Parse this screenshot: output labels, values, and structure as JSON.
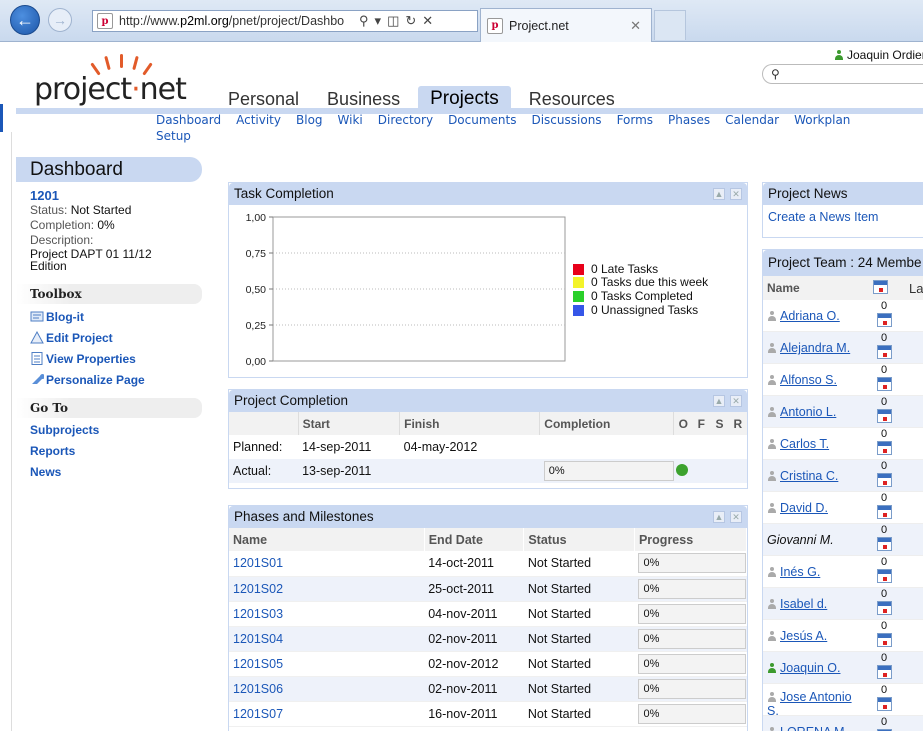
{
  "browser": {
    "url_prefix": "http://www.",
    "url_domain": "p2ml.org",
    "url_rest": "/pnet/project/Dashbo",
    "tab_title": "Project.net",
    "favicon_letter": "p"
  },
  "header": {
    "logo_text_a": "project",
    "logo_dot": "·",
    "logo_text_b": "net",
    "user_name": "Joaquin Ordieres",
    "main_nav": [
      "Personal",
      "Business",
      "Projects",
      "Resources"
    ],
    "sub_nav": [
      "Dashboard",
      "Activity",
      "Blog",
      "Wiki",
      "Directory",
      "Documents",
      "Discussions",
      "Forms",
      "Phases",
      "Calendar",
      "Workplan"
    ],
    "sub_nav_setup": "Setup"
  },
  "sidebar": {
    "title": "Dashboard",
    "project_id": "1201",
    "status_label": "Status:",
    "status_value": "Not Started",
    "completion_label": "Completion:",
    "completion_value": "0%",
    "description_label": "Description:",
    "description_value": "Project DAPT 01 11/12 Edition",
    "toolbox_title": "Toolbox",
    "toolbox": [
      "Blog-it",
      "Edit Project",
      "View Properties",
      "Personalize Page"
    ],
    "goto_title": "Go To",
    "goto": [
      "Subprojects",
      "Reports",
      "News"
    ]
  },
  "task_completion": {
    "title": "Task Completion",
    "legend": [
      "0 Late Tasks",
      "0 Tasks due this week",
      "0 Tasks Completed",
      "0 Unassigned Tasks"
    ]
  },
  "chart_data": {
    "type": "bar",
    "categories": [
      "Late Tasks",
      "Tasks due this week",
      "Tasks Completed",
      "Unassigned Tasks"
    ],
    "values": [
      0,
      0,
      0,
      0
    ],
    "colors": [
      "#e8001a",
      "#f3f32a",
      "#2ad02a",
      "#3556e8"
    ],
    "title": "",
    "xlabel": "",
    "ylabel": "",
    "ylim": [
      0,
      1
    ],
    "yticks": [
      "1,00",
      "0,75",
      "0,50",
      "0,25",
      "0,00"
    ],
    "grid": true,
    "legend_position": "right"
  },
  "project_completion": {
    "title": "Project Completion",
    "headers": [
      "",
      "Start",
      "Finish",
      "Completion",
      "O",
      "F",
      "S",
      "R"
    ],
    "rows": [
      {
        "label": "Planned:",
        "start": "14-sep-2011",
        "finish": "04-may-2012",
        "completion": ""
      },
      {
        "label": "Actual:",
        "start": "13-sep-2011",
        "finish": "",
        "completion": "0%"
      }
    ],
    "status_color": "#3ca22e"
  },
  "phases": {
    "title": "Phases and Milestones",
    "headers": [
      "Name",
      "End Date",
      "Status",
      "Progress"
    ],
    "rows": [
      {
        "name": "1201S01",
        "end": "14-oct-2011",
        "status": "Not Started",
        "progress": "0%"
      },
      {
        "name": "1201S02",
        "end": "25-oct-2011",
        "status": "Not Started",
        "progress": "0%"
      },
      {
        "name": "1201S03",
        "end": "04-nov-2011",
        "status": "Not Started",
        "progress": "0%"
      },
      {
        "name": "1201S04",
        "end": "02-nov-2011",
        "status": "Not Started",
        "progress": "0%"
      },
      {
        "name": "1201S05",
        "end": "02-nov-2012",
        "status": "Not Started",
        "progress": "0%"
      },
      {
        "name": "1201S06",
        "end": "02-nov-2011",
        "status": "Not Started",
        "progress": "0%"
      },
      {
        "name": "1201S07",
        "end": "16-nov-2011",
        "status": "Not Started",
        "progress": "0%"
      }
    ]
  },
  "project_news": {
    "title": "Project News",
    "create_link": "Create a News Item"
  },
  "project_team": {
    "title": "Project Team : 24 Membe",
    "col_name": "Name",
    "col_last": "La",
    "members": [
      {
        "name": "Adriana O.",
        "tasks": "0",
        "icon": "grey"
      },
      {
        "name": "Alejandra M.",
        "tasks": "0",
        "icon": "grey"
      },
      {
        "name": "Alfonso S.",
        "tasks": "0",
        "icon": "grey"
      },
      {
        "name": "Antonio L.",
        "tasks": "0",
        "icon": "grey"
      },
      {
        "name": "Carlos T.",
        "tasks": "0",
        "icon": "grey"
      },
      {
        "name": "Cristina C.",
        "tasks": "0",
        "icon": "grey"
      },
      {
        "name": "David D.",
        "tasks": "0",
        "icon": "grey"
      },
      {
        "name": "Giovanni M.",
        "tasks": "0",
        "icon": "none"
      },
      {
        "name": "Inés G.",
        "tasks": "0",
        "icon": "grey"
      },
      {
        "name": "Isabel d.",
        "tasks": "0",
        "icon": "grey"
      },
      {
        "name": "Jesús A.",
        "tasks": "0",
        "icon": "grey"
      },
      {
        "name": "Joaquin O.",
        "tasks": "0",
        "icon": "green"
      },
      {
        "name": "Jose Antonio S.",
        "tasks": "0",
        "icon": "grey"
      },
      {
        "name": "LORENA M.",
        "tasks": "0",
        "icon": "grey"
      }
    ]
  }
}
